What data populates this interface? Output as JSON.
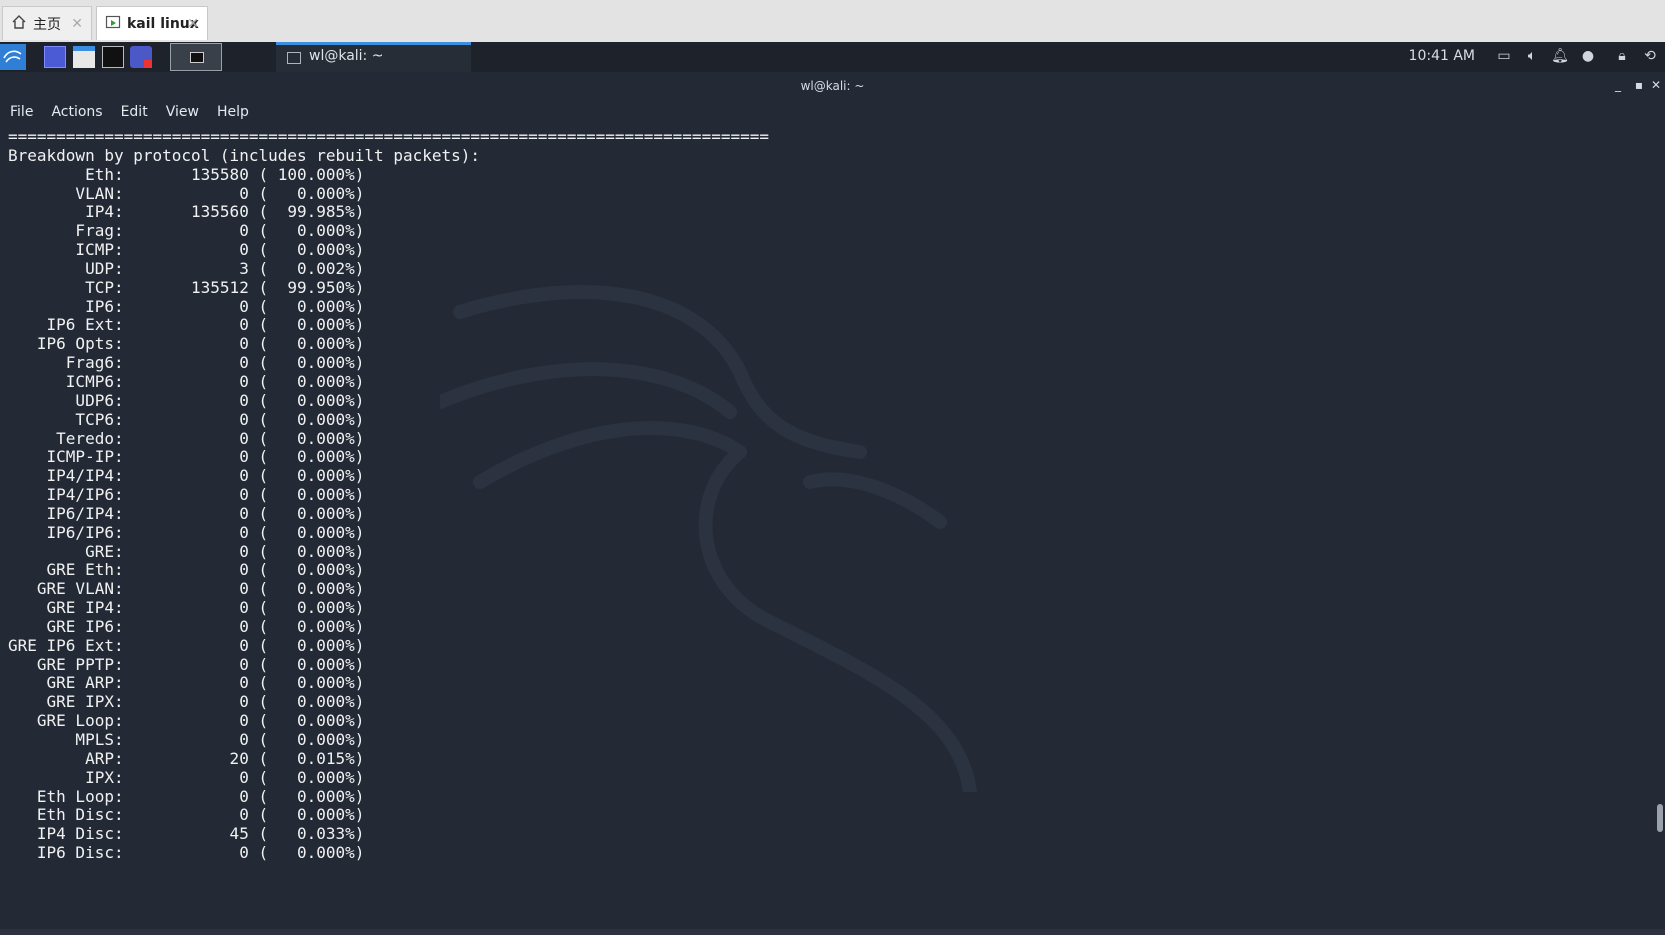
{
  "host_tabs": [
    {
      "label": "主页",
      "icon": "home-icon"
    },
    {
      "label": "kail linux",
      "icon": "vm-icon"
    }
  ],
  "panel": {
    "task_label": "wl@kali: ~",
    "clock": "10:41 AM",
    "tray_icons": [
      "display-icon",
      "volume-icon",
      "bell-icon",
      "network-icon",
      "lock-icon",
      "logout-icon"
    ]
  },
  "terminal": {
    "title": "wl@kali: ~",
    "menu": [
      "File",
      "Actions",
      "Edit",
      "View",
      "Help"
    ],
    "separator": "===============================================================================",
    "heading": "Breakdown by protocol (includes rebuilt packets):",
    "rows": [
      {
        "proto": "Eth",
        "count": "135580",
        "pct": "100.000%"
      },
      {
        "proto": "VLAN",
        "count": "0",
        "pct": "0.000%"
      },
      {
        "proto": "IP4",
        "count": "135560",
        "pct": "99.985%"
      },
      {
        "proto": "Frag",
        "count": "0",
        "pct": "0.000%"
      },
      {
        "proto": "ICMP",
        "count": "0",
        "pct": "0.000%"
      },
      {
        "proto": "UDP",
        "count": "3",
        "pct": "0.002%"
      },
      {
        "proto": "TCP",
        "count": "135512",
        "pct": "99.950%"
      },
      {
        "proto": "IP6",
        "count": "0",
        "pct": "0.000%"
      },
      {
        "proto": "IP6 Ext",
        "count": "0",
        "pct": "0.000%"
      },
      {
        "proto": "IP6 Opts",
        "count": "0",
        "pct": "0.000%"
      },
      {
        "proto": "Frag6",
        "count": "0",
        "pct": "0.000%"
      },
      {
        "proto": "ICMP6",
        "count": "0",
        "pct": "0.000%"
      },
      {
        "proto": "UDP6",
        "count": "0",
        "pct": "0.000%"
      },
      {
        "proto": "TCP6",
        "count": "0",
        "pct": "0.000%"
      },
      {
        "proto": "Teredo",
        "count": "0",
        "pct": "0.000%"
      },
      {
        "proto": "ICMP-IP",
        "count": "0",
        "pct": "0.000%"
      },
      {
        "proto": "IP4/IP4",
        "count": "0",
        "pct": "0.000%"
      },
      {
        "proto": "IP4/IP6",
        "count": "0",
        "pct": "0.000%"
      },
      {
        "proto": "IP6/IP4",
        "count": "0",
        "pct": "0.000%"
      },
      {
        "proto": "IP6/IP6",
        "count": "0",
        "pct": "0.000%"
      },
      {
        "proto": "GRE",
        "count": "0",
        "pct": "0.000%"
      },
      {
        "proto": "GRE Eth",
        "count": "0",
        "pct": "0.000%"
      },
      {
        "proto": "GRE VLAN",
        "count": "0",
        "pct": "0.000%"
      },
      {
        "proto": "GRE IP4",
        "count": "0",
        "pct": "0.000%"
      },
      {
        "proto": "GRE IP6",
        "count": "0",
        "pct": "0.000%"
      },
      {
        "proto": "GRE IP6 Ext",
        "count": "0",
        "pct": "0.000%"
      },
      {
        "proto": "GRE PPTP",
        "count": "0",
        "pct": "0.000%"
      },
      {
        "proto": "GRE ARP",
        "count": "0",
        "pct": "0.000%"
      },
      {
        "proto": "GRE IPX",
        "count": "0",
        "pct": "0.000%"
      },
      {
        "proto": "GRE Loop",
        "count": "0",
        "pct": "0.000%"
      },
      {
        "proto": "MPLS",
        "count": "0",
        "pct": "0.000%"
      },
      {
        "proto": "ARP",
        "count": "20",
        "pct": "0.015%"
      },
      {
        "proto": "IPX",
        "count": "0",
        "pct": "0.000%"
      },
      {
        "proto": "Eth Loop",
        "count": "0",
        "pct": "0.000%"
      },
      {
        "proto": "Eth Disc",
        "count": "0",
        "pct": "0.000%"
      },
      {
        "proto": "IP4 Disc",
        "count": "45",
        "pct": "0.033%"
      },
      {
        "proto": "IP6 Disc",
        "count": "0",
        "pct": "0.000%"
      }
    ]
  },
  "colors": {
    "terminal_bg": "#232a36",
    "panel_bg": "#1d222b",
    "accent": "#3d8fe0",
    "text": "#f1f1f1"
  }
}
